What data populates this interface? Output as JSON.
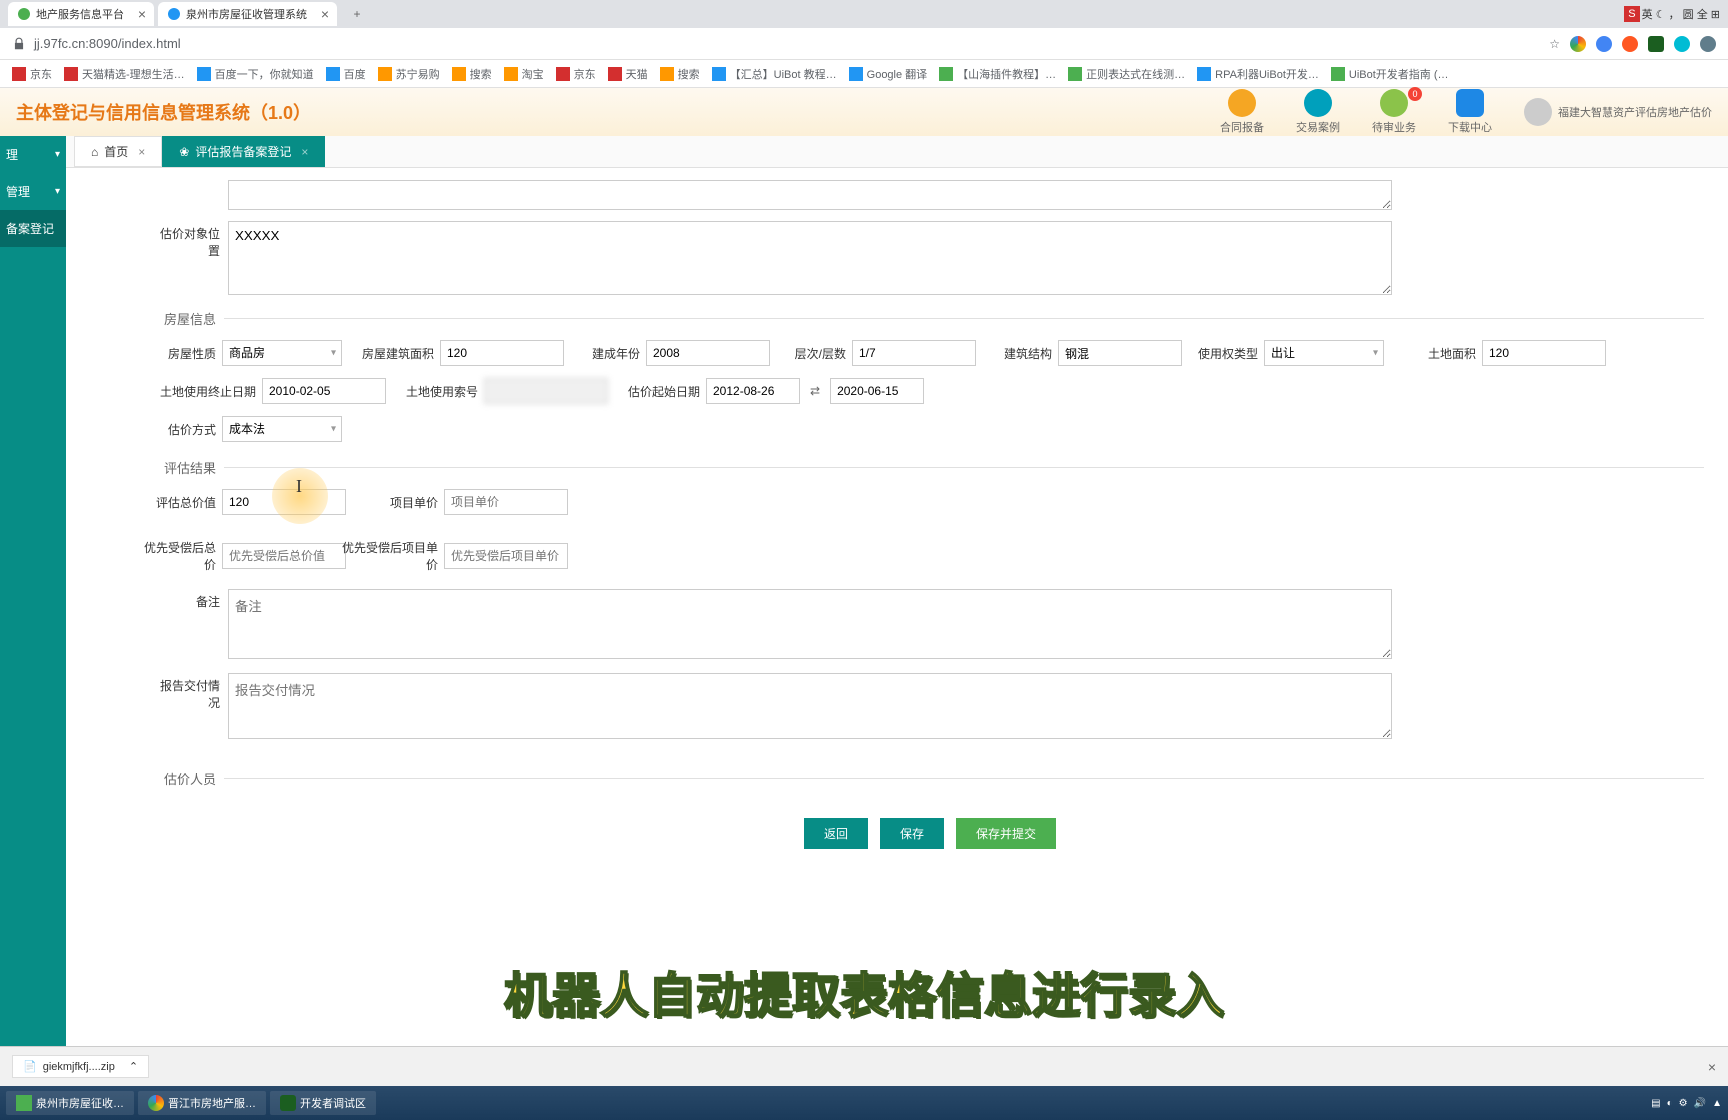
{
  "browser": {
    "tabs": [
      {
        "title": "地产服务信息平台"
      },
      {
        "title": "泉州市房屋征收管理系统"
      }
    ],
    "url": "jj.97fc.cn:8090/index.html",
    "ime": {
      "badge": "S",
      "text": "英 ☾ ，  圆 全 ⊞"
    }
  },
  "bookmarks": [
    {
      "label": "京东"
    },
    {
      "label": "天猫精选-理想生活…"
    },
    {
      "label": "百度一下，你就知道"
    },
    {
      "label": "百度"
    },
    {
      "label": "苏宁易购"
    },
    {
      "label": "搜索"
    },
    {
      "label": "淘宝"
    },
    {
      "label": "京东"
    },
    {
      "label": "天猫"
    },
    {
      "label": "搜索"
    },
    {
      "label": "【汇总】UiBot 教程…"
    },
    {
      "label": "Google 翻译"
    },
    {
      "label": "【山海插件教程】…"
    },
    {
      "label": "正则表达式在线测…"
    },
    {
      "label": "RPA利器UiBot开发…"
    },
    {
      "label": "UiBot开发者指南 (…"
    }
  ],
  "app": {
    "title": "主体登记与信用信息管理系统（1.0）",
    "headerIcons": [
      {
        "label": "合同报备",
        "color": "#f5a623"
      },
      {
        "label": "交易案例",
        "color": "#00a0bc"
      },
      {
        "label": "待审业务",
        "color": "#8bc34a",
        "badge": "0"
      },
      {
        "label": "下载中心",
        "color": "#1e88e5"
      }
    ],
    "user": "福建大智慧资产评估房地产估价"
  },
  "sidebar": [
    {
      "label": "理"
    },
    {
      "label": "管理"
    },
    {
      "label": "备案登记"
    }
  ],
  "contentTabs": [
    {
      "label": "首页",
      "icon": "⌂"
    },
    {
      "label": "评估报告备案登记",
      "icon": "❀",
      "active": true
    }
  ],
  "form": {
    "locationLabel": "估价对象位置",
    "locationValue": "XXXXX",
    "sectionHouse": "房屋信息",
    "houseType": {
      "label": "房屋性质",
      "value": "商品房"
    },
    "buildArea": {
      "label": "房屋建筑面积",
      "value": "120"
    },
    "buildYear": {
      "label": "建成年份",
      "value": "2008"
    },
    "floors": {
      "label": "层次/层数",
      "value": "1/7"
    },
    "structure": {
      "label": "建筑结构",
      "value": "钢混"
    },
    "rightType": {
      "label": "使用权类型",
      "value": "出让"
    },
    "landArea": {
      "label": "土地面积",
      "value": "120"
    },
    "landEndDate": {
      "label": "土地使用终止日期",
      "value": "2010-02-05"
    },
    "landIndex": {
      "label": "土地使用索号",
      "value": ""
    },
    "valStartDate": {
      "label": "估价起始日期",
      "from": "2012-08-26",
      "to": "2020-06-15"
    },
    "valMethod": {
      "label": "估价方式",
      "value": "成本法"
    },
    "sectionResult": "评估结果",
    "totalValue": {
      "label": "评估总价值",
      "value": "120"
    },
    "unitPrice": {
      "label": "项目单价",
      "placeholder": "项目单价"
    },
    "priorTotal": {
      "label": "优先受偿后总价",
      "placeholder": "优先受偿后总价值"
    },
    "priorUnit": {
      "label": "优先受偿后项目单价",
      "placeholder": "优先受偿后项目单价"
    },
    "remark": {
      "label": "备注",
      "placeholder": "备注"
    },
    "delivery": {
      "label": "报告交付情况",
      "placeholder": "报告交付情况"
    },
    "sectionStaff": "估价人员",
    "buttons": {
      "back": "返回",
      "save": "保存",
      "submit": "保存并提交"
    }
  },
  "subtitle": "机器人自动提取表格信息进行录入",
  "download": {
    "file": "giekmjfkfj....zip"
  },
  "taskbar": [
    {
      "label": "泉州市房屋征收…"
    },
    {
      "label": "晋江市房地产服…"
    },
    {
      "label": "开发者调试区"
    }
  ]
}
